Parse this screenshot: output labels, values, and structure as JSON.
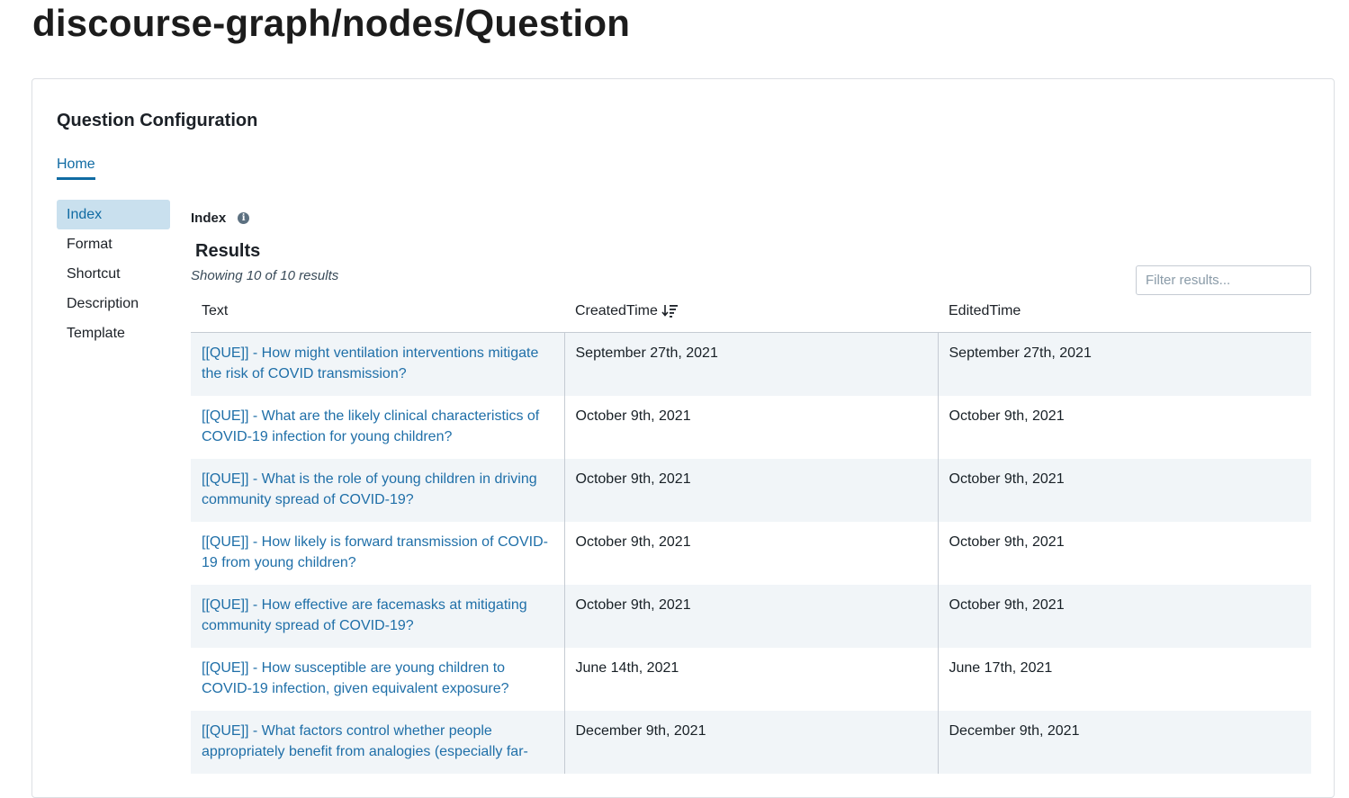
{
  "page": {
    "title": "discourse-graph/nodes/Question"
  },
  "config": {
    "title": "Question Configuration",
    "tabs": [
      {
        "label": "Home",
        "active": true
      }
    ],
    "sidebar": {
      "items": [
        {
          "label": "Index",
          "active": true
        },
        {
          "label": "Format",
          "active": false
        },
        {
          "label": "Shortcut",
          "active": false
        },
        {
          "label": "Description",
          "active": false
        },
        {
          "label": "Template",
          "active": false
        }
      ]
    },
    "panel": {
      "label": "Index",
      "info_icon": "info-icon",
      "results_title": "Results",
      "results_count": "Showing 10 of 10 results",
      "filter_placeholder": "Filter results...",
      "filter_value": "",
      "columns": [
        {
          "label": "Text",
          "sorted": false
        },
        {
          "label": "CreatedTime",
          "sorted": true,
          "sort_icon": "sort-descending-icon"
        },
        {
          "label": "EditedTime",
          "sorted": false
        }
      ],
      "rows": [
        {
          "text": "[[QUE]] - How might ventilation interventions mitigate the risk of COVID transmission?",
          "created": "September 27th, 2021",
          "edited": "September 27th, 2021"
        },
        {
          "text": "[[QUE]] - What are the likely clinical characteristics of COVID-19 infection for young children?",
          "created": "October 9th, 2021",
          "edited": "October 9th, 2021"
        },
        {
          "text": "[[QUE]] - What is the role of young children in driving community spread of COVID-19?",
          "created": "October 9th, 2021",
          "edited": "October 9th, 2021"
        },
        {
          "text": "[[QUE]] - How likely is forward transmission of COVID-19 from young children?",
          "created": "October 9th, 2021",
          "edited": "October 9th, 2021"
        },
        {
          "text": "[[QUE]] - How effective are facemasks at mitigating community spread of COVID-19?",
          "created": "October 9th, 2021",
          "edited": "October 9th, 2021"
        },
        {
          "text": "[[QUE]] - How susceptible are young children to COVID-19 infection, given equivalent exposure?",
          "created": "June 14th, 2021",
          "edited": "June 17th, 2021"
        },
        {
          "text": "[[QUE]] - What factors control whether people appropriately benefit from analogies (especially far-",
          "created": "December 9th, 2021",
          "edited": "December 9th, 2021"
        }
      ]
    }
  },
  "colors": {
    "link": "#1f6fa8",
    "active_tab": "#106ba3",
    "active_sidebar_bg": "#c9e0ee",
    "row_stripe": "#f1f5f8"
  }
}
